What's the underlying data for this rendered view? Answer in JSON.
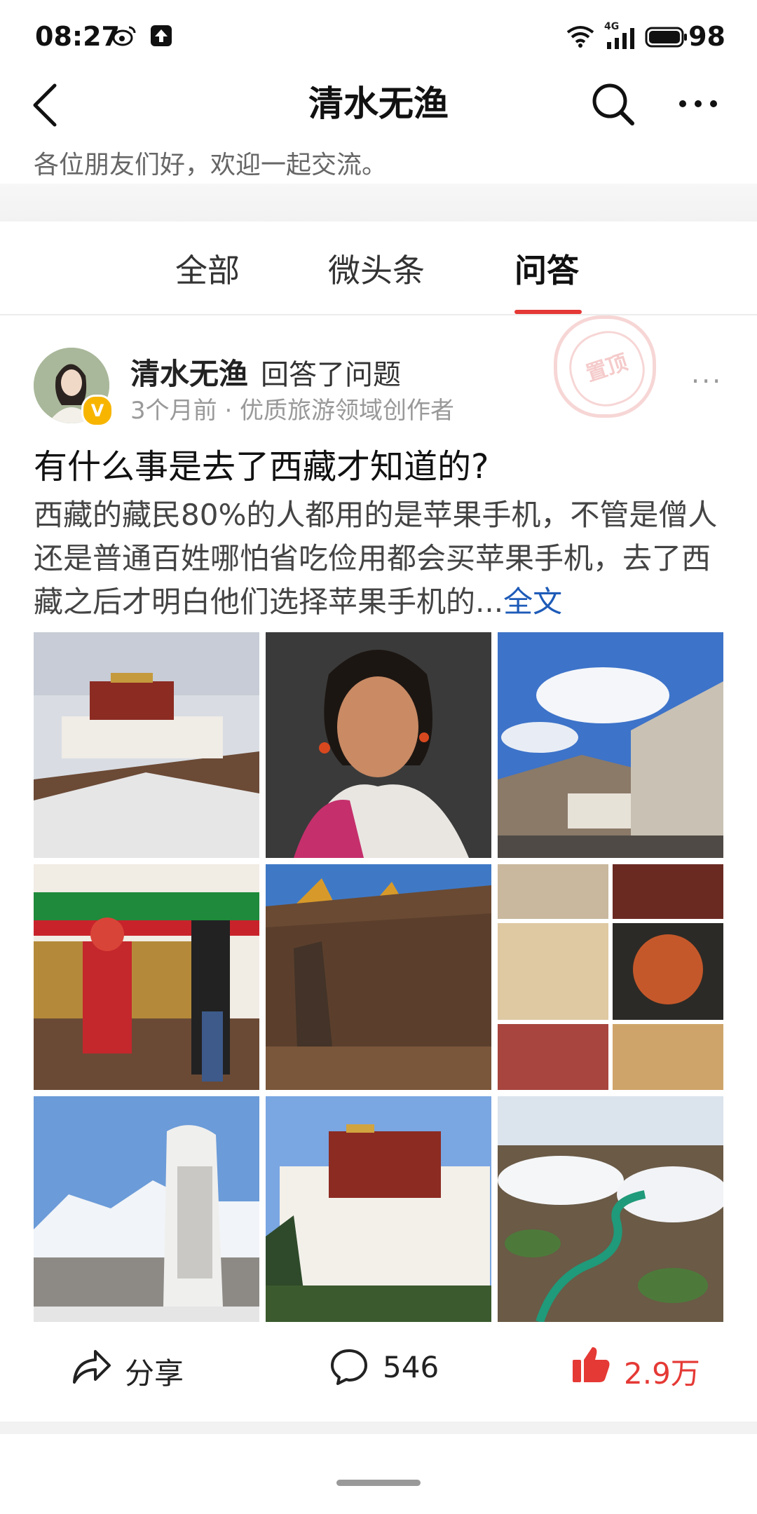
{
  "status_bar": {
    "time": "08:27",
    "network": "4G",
    "battery": "98"
  },
  "header": {
    "title": "清水无渔",
    "subtitle": "各位朋友们好，欢迎一起交流。"
  },
  "tabs": [
    {
      "label": "全部",
      "active": false
    },
    {
      "label": "微头条",
      "active": false
    },
    {
      "label": "问答",
      "active": true
    }
  ],
  "post": {
    "author": "清水无渔",
    "action": "回答了问题",
    "meta": "3个月前 · 优质旅游领域创作者",
    "stamp": "置顶",
    "question": "有什么事是去了西藏才知道的?",
    "excerpt": "西藏的藏民80%的人都用的是苹果手机，不管是僧人还是普通百姓哪怕省吃俭用都会买苹果手机，去了西藏之后才明白他们选择苹果手机的...",
    "full_text_link": "全文"
  },
  "actions": {
    "share_label": "分享",
    "comment_count": "546",
    "like_count": "2.9万"
  },
  "colors": {
    "accent": "#e53935",
    "link": "#1e5bb8",
    "like": "#e53935"
  },
  "icons": [
    "weibo-icon",
    "upload-icon",
    "wifi-icon",
    "signal-icon",
    "battery-icon",
    "back-icon",
    "search-icon",
    "more-icon",
    "share-icon",
    "comment-icon",
    "thumbs-up-icon"
  ]
}
